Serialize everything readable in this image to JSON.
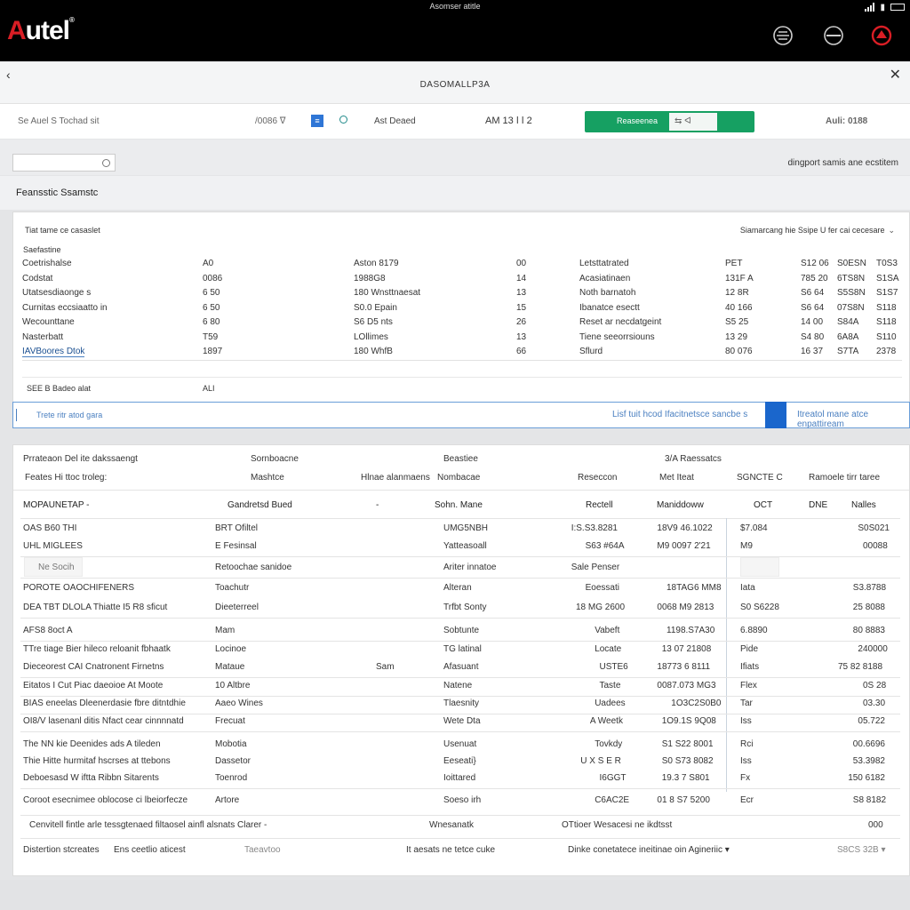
{
  "topbar": {
    "logo_mark": "A",
    "logo_rest": "utel",
    "logo_reg": "®",
    "status_title": "Asomser atitle"
  },
  "header": {
    "title": "DASOMALLP3A",
    "info": {
      "left": "Se Auel S Tochad sit",
      "num": "/0086 ᐁ",
      "square": "≡",
      "right_label": "Ast Deaed",
      "code": "AM 13 ǀ ǀ 2",
      "button_label": "Reaseenea",
      "button_inner": "⇆ ᐊ",
      "brand_label": "Auli: 0188"
    }
  },
  "search": {
    "placeholder": "",
    "hint": "dingport samis ane ecstitem"
  },
  "section": {
    "title": "Feansstic Ssamstc"
  },
  "panel1": {
    "title": "Tiat tame ce casaslet",
    "right": "Siamarcang hie Ssipe U fer cai cecesare",
    "sub": "Saefastine",
    "rows": [
      [
        "Coetrishalse",
        "A0",
        "Aston 8179",
        "00",
        "Letsttatrated",
        "PET",
        "S12 06",
        "S0ESN",
        "T0S3"
      ],
      [
        "Codstat",
        "0086",
        "1988G8",
        "14",
        "Acasiatinaen",
        "131F A",
        "785 20",
        "6TS8N",
        "S1SA"
      ],
      [
        "Utatsesdiaonge s",
        "6 50",
        "180 Wnsttnaesat",
        "13",
        "Noth barnatoh",
        "12 8R",
        "S6 64",
        "S5S8N",
        "S1S7"
      ],
      [
        "Curnitas eccsiaatto in",
        "6 50",
        "S0.0 Epain",
        "15",
        "Ibanatce esectt",
        "40 166",
        "S6 64",
        "07S8N",
        "S118"
      ],
      [
        "Wecounttane",
        "6 80",
        "S6 D5 nts",
        "26",
        "Reset ar necdatgeint",
        "S5 25",
        "14 00",
        "S84A",
        "S118"
      ],
      [
        "Nasterbatt",
        "T59",
        "LOllimes",
        "13",
        "Tiene seeorrsiouns",
        "13 29",
        "S4 80",
        "6A8A",
        "S110"
      ],
      [
        "IAVBoores Dtok",
        "1897",
        "180 WhfB",
        "66",
        "Sflurd",
        "80 076",
        "16 37",
        "S7TA",
        "2378"
      ]
    ],
    "selected_label": "SEE B Badeo alat",
    "selected_value": "ALI"
  },
  "filter_bar": {
    "left": "Trete ritr atod gara",
    "middle": "Lisf tuit hcod Ifacitnetsce sancbe s",
    "right": "Itreatol mane atce enpattiream"
  },
  "panel2": {
    "head1": [
      "Prrateaon Del ite dakssaengt",
      "Sornboacne",
      "Beastiee",
      "3/A Raessatcs"
    ],
    "head2": [
      "Feates Hi ttoc troleg:",
      "Mashtce",
      "Hlnae alanmaens",
      "Nombacae",
      "Reseccon",
      "Met Iteat",
      "SGNCTE C",
      "Ramoele tirr taree"
    ],
    "table_head": [
      "MOPAUNETAP -",
      "Gandretsd Bued",
      "-",
      "Sohn. Mane",
      "Rectell",
      "Maniddoww",
      "OCT",
      "DNE",
      "Nalles"
    ],
    "rows": [
      [
        "OAS B60 THI",
        "BRT Ofiltel",
        "",
        "UMG5NBH",
        "I:S.S3.8281",
        "18V9 46.1022",
        "$7.084",
        "",
        "S0S021"
      ],
      [
        "UHL MIGLEES",
        "E Fesinsal",
        "",
        "Yatteasoall",
        "S63 #64A",
        "M9 0097 2'21",
        "M9",
        "",
        "00088"
      ],
      [
        "Ne Socih",
        "Retoochae sanidoe",
        "",
        "Ariter innatoe",
        "Sale Penser",
        "",
        "",
        "",
        ""
      ],
      [
        "POROTE OAOCHIFENERS",
        "Toachutr",
        "",
        "Alteran",
        "Eoessati",
        "18TAG6 MM8",
        "Iata",
        "",
        "S3.8788"
      ],
      [
        "DEA TBT DLOLA Thiatte I5 R8 sficut",
        "Dieeterreel",
        "",
        "Trfbt Sonty",
        "18 MG 2600",
        "0068 M9 2813",
        "S0 S6228",
        "",
        "25 8088"
      ],
      [
        "AFS8 8oct A",
        "Mam",
        "",
        "Sobtunte",
        "Vabeft",
        "1198.S7A30",
        "6.8890",
        "",
        "80 8883"
      ],
      [
        "TTre tiage Bier hileco reloanit fbhaatk",
        "Locinoe",
        "",
        "TG latinal",
        "Locate",
        "13 07 21808",
        "Pide",
        "",
        "240000"
      ],
      [
        "Dieceorest CAI Cnatronent Firnetns",
        "Mataue",
        "Sam",
        "Afasuant",
        "USTE6",
        "18773 6 8111",
        "Ifiats",
        "",
        "75 82 8188"
      ],
      [
        "Eitatos I Cut Piac daeoioe At Moote",
        "10 Altbre",
        "",
        "Natene",
        "Taste",
        "0087.073 MG3",
        "Flex",
        "",
        "0S 28"
      ],
      [
        "BIAS eneelas Dleenerdasie fbre ditntdhie",
        "Aaeo Wines",
        "",
        "Tlaesnity",
        "Uadees",
        "1O3C2S0B0",
        "Tar",
        "",
        "03.30"
      ],
      [
        "OI8/V lasenanl ditis Nfact cear cinnnnatd",
        "Frecuat",
        "",
        "Wete Dta",
        "A Weetk",
        "1O9.1S 9Q08",
        "Iss",
        "",
        "05.722"
      ],
      [
        "The NN kie Deenides ads A tileden",
        "Mobotia",
        "",
        "Usenuat",
        "Tovkdy",
        "S1 S22 8001",
        "Rci",
        "",
        "00.6696"
      ],
      [
        "Thie Hitte hurmitaf hscrses at ttebons",
        "Dassetor",
        "",
        "Eeseati}",
        "U X S E R",
        "S0 S73 8082",
        "Iss",
        "",
        "53.3982"
      ],
      [
        "Deboesasd W iftta Ribbn Sitarents",
        "Toenrod",
        "",
        "Ioittared",
        "I6GGT",
        "19.3 7 S801",
        "Fx",
        "",
        "150 6182"
      ],
      [
        "Coroot esecnimee oblocose ci lbeiorfecze",
        "Artore",
        "",
        "Soeso irh",
        "C6AC2E",
        "01 8 S7 5200",
        "Ecr",
        "",
        "S8 8182"
      ]
    ],
    "foot1": [
      "Cenvitell fintle arle tessgtenaed filtaosel ainfl alsnats Clarer -",
      "Wnesanatk",
      "OTtioer Wesacesi ne ikdtsst",
      "000"
    ],
    "foot2": [
      "Distertion stcreates",
      "Ens ceetlio aticest",
      "Taeavtoo",
      "It aesats ne tetce cuke",
      "Dinke conetatece ineitinae oin Agineriic ▾",
      "S8CS 32B ▾"
    ]
  }
}
